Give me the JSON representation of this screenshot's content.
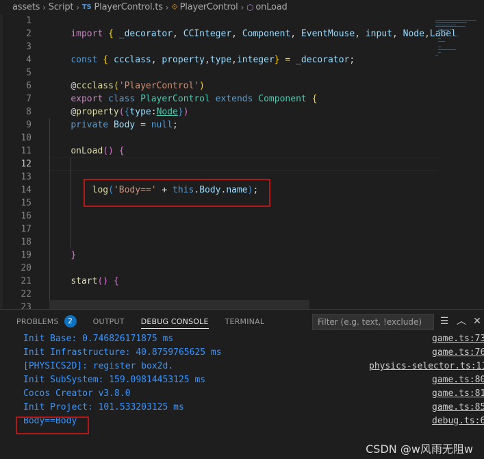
{
  "breadcrumb": {
    "items": [
      "assets",
      "Script",
      "PlayerControl.ts",
      "PlayerControl",
      "onLoad"
    ],
    "file_icon": "TS"
  },
  "editor": {
    "line_numbers": [
      "1",
      "2",
      "3",
      "4",
      "5",
      "6",
      "7",
      "8",
      "9",
      "10",
      "11",
      "12",
      "13",
      "14",
      "15",
      "16",
      "17",
      "18",
      "19",
      "20",
      "21",
      "22",
      "23"
    ],
    "active_line": "12"
  },
  "code": {
    "l1": {
      "kw": "import",
      "a": " { ",
      "b": "_decorator",
      "c": ", ",
      "d": "CCInteger",
      "e": ", ",
      "f": "Component",
      "g": ", ",
      "h": "EventMouse",
      "i": ", ",
      "j": "input",
      "k": ", ",
      "l": "Node",
      "m": ",",
      "n": "Label"
    },
    "l3": {
      "kw": "const",
      "a": " { ",
      "b": "ccclass",
      "c": ", ",
      "d": "property",
      "e": ",",
      "f": "type",
      "g": ",",
      "h": "integer",
      "i": "} = ",
      "j": "_decorator",
      "k": ";"
    },
    "l5": {
      "at": "@",
      "fn": "ccclass",
      "p1": "(",
      "s": "'PlayerControl'",
      "p2": ")"
    },
    "l6": {
      "k1": "export",
      "k2": "class",
      "c1": "PlayerControl",
      "k3": "extends",
      "c2": "Component",
      "b": "{"
    },
    "l8": {
      "at": "@",
      "fn": "property",
      "p1": "(",
      "b1": "{",
      "t": "type",
      "colon": ":",
      "n": "Node",
      "b2": "}",
      "p2": ")"
    },
    "l9": {
      "k": "private",
      "v": "Body",
      "eq": " = ",
      "nul": "null",
      "semi": ";"
    },
    "l11": {
      "fn": "onLoad",
      "p": "()",
      "b": "{"
    },
    "l14": {
      "fn": "log",
      "p1": "(",
      "s": "'Body=='",
      "plus": " + ",
      "t": "this",
      "d1": ".",
      "v": "Body",
      "d2": ".",
      "n": "name",
      "p2": ")",
      "semi": ";"
    },
    "l19": {
      "b": "}"
    },
    "l21": {
      "fn": "start",
      "p": "()",
      "b": "{"
    }
  },
  "panel": {
    "tabs": [
      "PROBLEMS",
      "OUTPUT",
      "DEBUG CONSOLE",
      "TERMINAL"
    ],
    "active_tab": "DEBUG CONSOLE",
    "problems_count": "2",
    "filter_placeholder": "Filter (e.g. text, !exclude)",
    "logs": [
      {
        "text": "Init Base: 0.746826171875 ms",
        "source": "game.ts:73"
      },
      {
        "text": "Init Infrastructure: 40.8759765625 ms",
        "source": "game.ts:76"
      },
      {
        "text": "[PHYSICS2D]: register box2d.",
        "source": "physics-selector.ts:11"
      },
      {
        "text": "Init SubSystem: 159.09814453125 ms",
        "source": "game.ts:80"
      },
      {
        "text": "Cocos Creator v3.8.0",
        "source": "game.ts:81"
      },
      {
        "text": "Init Project: 101.533203125 ms",
        "source": "game.ts:85"
      },
      {
        "text": "Body==Body",
        "source": "debug.ts:6"
      }
    ]
  },
  "watermark": "CSDN @w风雨无阻w",
  "colors": {
    "accent": "#0e70c0",
    "log_text": "#3794ff",
    "highlight_box": "#b4191a"
  }
}
